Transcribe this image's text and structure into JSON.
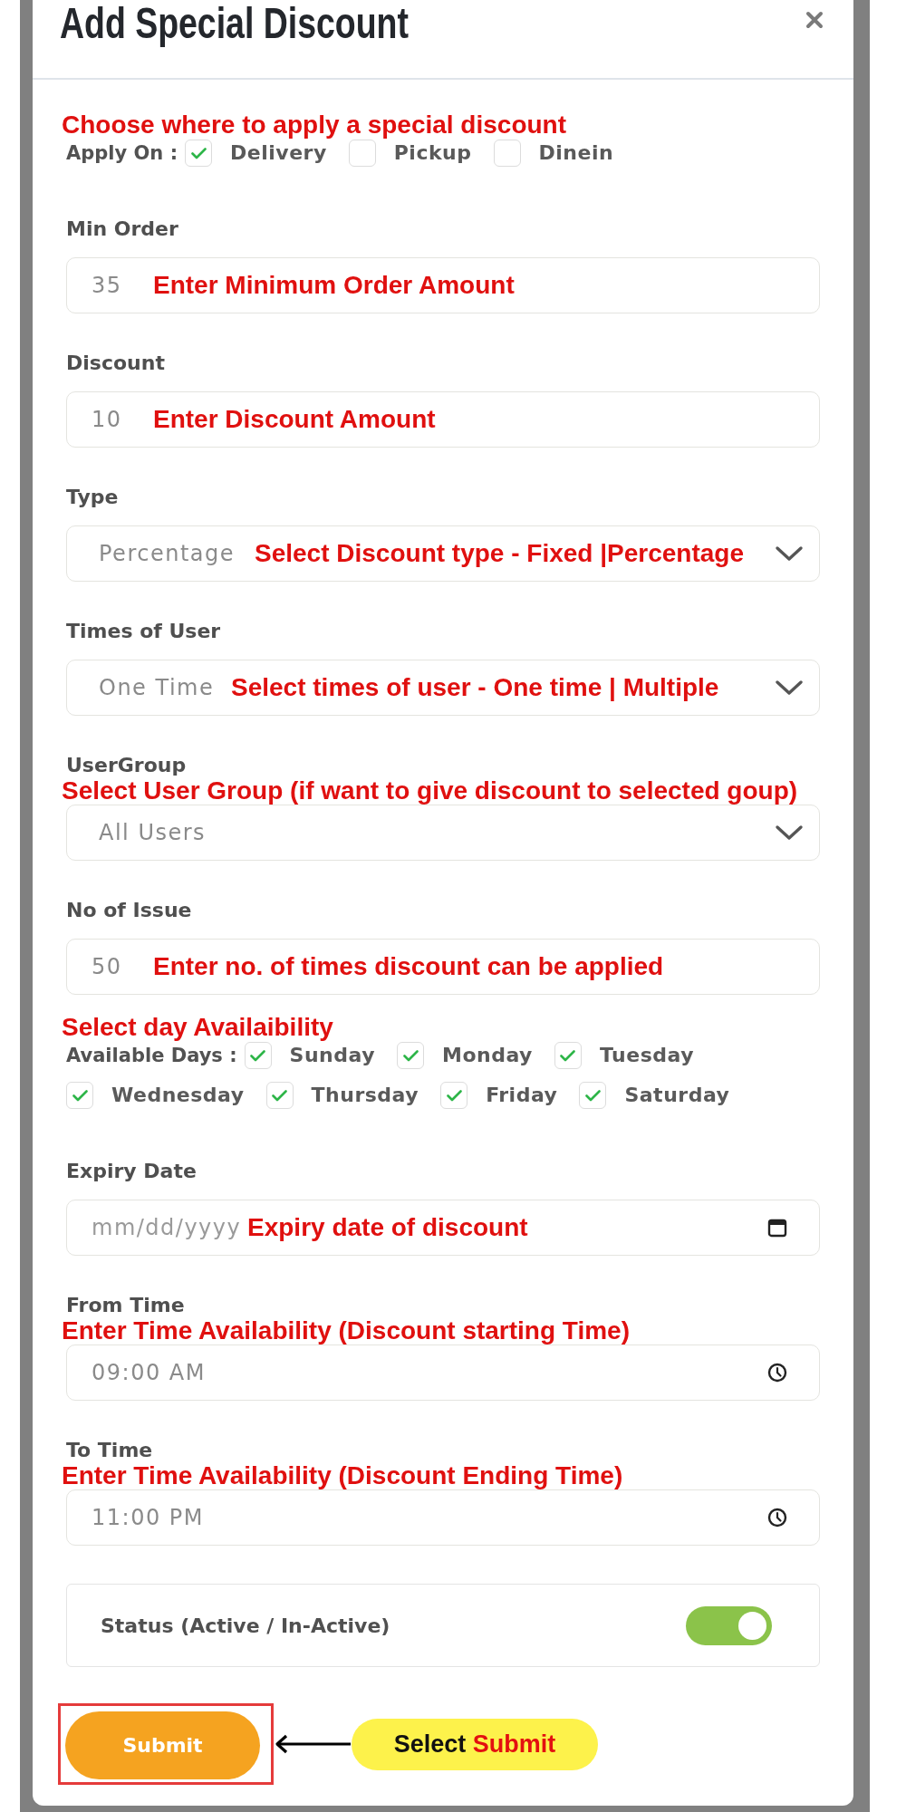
{
  "dialog": {
    "title": "Add Special Discount"
  },
  "form": [
    {
      "kind": "checkboxes",
      "note": {
        "text": "Choose where to apply a special discount",
        "kind": "above"
      },
      "label": "Apply On :",
      "options": [
        {
          "label": "Delivery",
          "checked": true
        },
        {
          "label": "Pickup",
          "checked": false
        },
        {
          "label": "Dinein",
          "checked": false
        }
      ]
    },
    {
      "kind": "input",
      "label": "Min Order",
      "value": "35",
      "note": {
        "text": "Enter Minimum Order Amount",
        "kind": "inline"
      }
    },
    {
      "kind": "input",
      "label": "Discount",
      "value": "10",
      "note": {
        "text": "Enter Discount Amount",
        "kind": "inline"
      }
    },
    {
      "kind": "select",
      "label": "Type",
      "value": "Percentage",
      "note": {
        "text": "Select Discount type - Fixed |Percentage",
        "kind": "inline"
      }
    },
    {
      "kind": "select",
      "label": "Times of User",
      "value": "One Time",
      "note": {
        "text": "Select times of user - One time | Multiple",
        "kind": "inline"
      }
    },
    {
      "kind": "select",
      "label": "UserGroup",
      "value": "All Users",
      "note": {
        "text": "Select User Group (if want to give discount to selected goup)",
        "kind": "above"
      }
    },
    {
      "kind": "input",
      "label": "No of Issue",
      "value": "50",
      "note": {
        "text": "Enter no. of times discount can be applied",
        "kind": "inline"
      }
    },
    {
      "kind": "checkboxes",
      "note": {
        "text": "Select day Availaibility",
        "kind": "above"
      },
      "label": "Available Days :",
      "options": [
        {
          "label": "Sunday",
          "checked": true
        },
        {
          "label": "Monday",
          "checked": true
        },
        {
          "label": "Tuesday",
          "checked": true
        },
        {
          "label": "Wednesday",
          "checked": true
        },
        {
          "label": "Thursday",
          "checked": true
        },
        {
          "label": "Friday",
          "checked": true
        },
        {
          "label": "Saturday",
          "checked": true
        }
      ]
    },
    {
      "kind": "date",
      "label": "Expiry Date",
      "placeholder": "mm/dd/yyyy",
      "note": {
        "text": "Expiry date of discount",
        "kind": "inline"
      }
    },
    {
      "kind": "time",
      "label": "From Time",
      "value": "09:00 AM",
      "note": {
        "text": "Enter Time Availability (Discount starting Time)",
        "kind": "above"
      }
    },
    {
      "kind": "time",
      "label": "To Time",
      "value": "11:00 PM",
      "note": {
        "text": "Enter Time Availability (Discount Ending Time)",
        "kind": "above"
      }
    },
    {
      "kind": "toggle",
      "label": "Status (Active / In-Active)",
      "on": true
    }
  ],
  "submit": {
    "label": "Submit",
    "highlighted": true
  },
  "callout": {
    "text": "Select",
    "highlight": "Submit"
  }
}
